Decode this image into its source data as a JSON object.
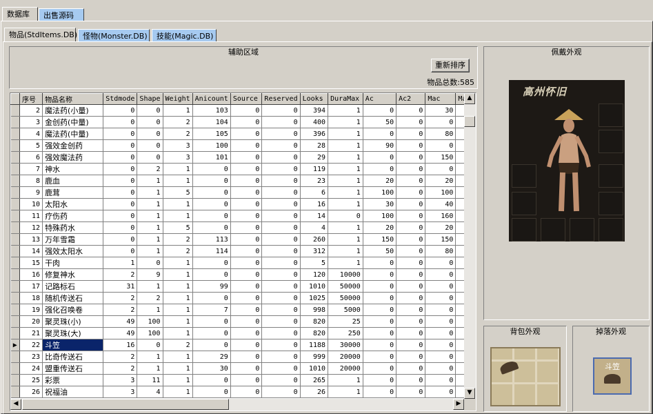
{
  "top_tabs": [
    "数据库",
    "出售源码"
  ],
  "db_tabs": [
    "物品(StdItems.DB)",
    "怪物(Monster.DB)",
    "技能(Magic.DB)"
  ],
  "aux": {
    "title": "辅助区域",
    "resort_button": "重新排序",
    "total_label": "物品总数:585"
  },
  "panels": {
    "wear_title": "佩戴外观",
    "bag_title": "背包外观",
    "drop_title": "掉落外观",
    "drop_item_label": "斗笠",
    "wear_banner": "高州怀旧"
  },
  "columns": [
    "",
    "序号",
    "物品名称",
    "Stdmode",
    "Shape",
    "Weight",
    "Anicount",
    "Source",
    "Reserved",
    "Looks",
    "DuraMax",
    "Ac",
    "Ac2",
    "Mac",
    "Ma"
  ],
  "rows": [
    [
      "2",
      "魔法药(小量)",
      "0",
      "0",
      "1",
      "103",
      "0",
      "0",
      "394",
      "1",
      "0",
      "0",
      "30"
    ],
    [
      "3",
      "金创药(中量)",
      "0",
      "0",
      "2",
      "104",
      "0",
      "0",
      "400",
      "1",
      "50",
      "0",
      "0"
    ],
    [
      "4",
      "魔法药(中量)",
      "0",
      "0",
      "2",
      "105",
      "0",
      "0",
      "396",
      "1",
      "0",
      "0",
      "80"
    ],
    [
      "5",
      "强效金创药",
      "0",
      "0",
      "3",
      "100",
      "0",
      "0",
      "28",
      "1",
      "90",
      "0",
      "0"
    ],
    [
      "6",
      "强效魔法药",
      "0",
      "0",
      "3",
      "101",
      "0",
      "0",
      "29",
      "1",
      "0",
      "0",
      "150"
    ],
    [
      "7",
      "神水",
      "0",
      "2",
      "1",
      "0",
      "0",
      "0",
      "119",
      "1",
      "0",
      "0",
      "0"
    ],
    [
      "8",
      "鹿血",
      "0",
      "1",
      "1",
      "0",
      "0",
      "0",
      "23",
      "1",
      "20",
      "0",
      "20"
    ],
    [
      "9",
      "鹿茸",
      "0",
      "1",
      "5",
      "0",
      "0",
      "0",
      "6",
      "1",
      "100",
      "0",
      "100"
    ],
    [
      "10",
      "太阳水",
      "0",
      "1",
      "1",
      "0",
      "0",
      "0",
      "16",
      "1",
      "30",
      "0",
      "40"
    ],
    [
      "11",
      "疗伤药",
      "0",
      "1",
      "1",
      "0",
      "0",
      "0",
      "14",
      "0",
      "100",
      "0",
      "160"
    ],
    [
      "12",
      "特殊药水",
      "0",
      "1",
      "5",
      "0",
      "0",
      "0",
      "4",
      "1",
      "20",
      "0",
      "20"
    ],
    [
      "13",
      "万年雪霜",
      "0",
      "1",
      "2",
      "113",
      "0",
      "0",
      "260",
      "1",
      "150",
      "0",
      "150"
    ],
    [
      "14",
      "强效太阳水",
      "0",
      "1",
      "2",
      "114",
      "0",
      "0",
      "312",
      "1",
      "50",
      "0",
      "80"
    ],
    [
      "15",
      "干肉",
      "1",
      "0",
      "1",
      "0",
      "0",
      "0",
      "5",
      "1",
      "0",
      "0",
      "0"
    ],
    [
      "16",
      "修复神水",
      "2",
      "9",
      "1",
      "0",
      "0",
      "0",
      "120",
      "10000",
      "0",
      "0",
      "0"
    ],
    [
      "17",
      "记路标石",
      "31",
      "1",
      "1",
      "99",
      "0",
      "0",
      "1010",
      "50000",
      "0",
      "0",
      "0"
    ],
    [
      "18",
      "随机传送石",
      "2",
      "2",
      "1",
      "0",
      "0",
      "0",
      "1025",
      "50000",
      "0",
      "0",
      "0"
    ],
    [
      "19",
      "强化召唤卷",
      "2",
      "1",
      "1",
      "7",
      "0",
      "0",
      "998",
      "5000",
      "0",
      "0",
      "0"
    ],
    [
      "20",
      "聚灵珠(小)",
      "49",
      "100",
      "1",
      "0",
      "0",
      "0",
      "820",
      "25",
      "0",
      "0",
      "0"
    ],
    [
      "21",
      "聚灵珠(大)",
      "49",
      "100",
      "1",
      "0",
      "0",
      "0",
      "820",
      "250",
      "0",
      "0",
      "0"
    ],
    [
      "22",
      "斗笠",
      "16",
      "0",
      "2",
      "0",
      "0",
      "0",
      "1188",
      "30000",
      "0",
      "0",
      "0"
    ],
    [
      "23",
      "比奇传送石",
      "2",
      "1",
      "1",
      "29",
      "0",
      "0",
      "999",
      "20000",
      "0",
      "0",
      "0"
    ],
    [
      "24",
      "盟重传送石",
      "2",
      "1",
      "1",
      "30",
      "0",
      "0",
      "1010",
      "20000",
      "0",
      "0",
      "0"
    ],
    [
      "25",
      "彩票",
      "3",
      "11",
      "1",
      "0",
      "0",
      "0",
      "265",
      "1",
      "0",
      "0",
      "0"
    ],
    [
      "26",
      "祝福油",
      "3",
      "4",
      "1",
      "0",
      "0",
      "0",
      "26",
      "1",
      "0",
      "0",
      "0"
    ]
  ],
  "selected_row_index": 20,
  "colors": {
    "tab_unselected": "#a6caf0",
    "selection": "#0a246a",
    "window_bg": "#d4d0c8"
  }
}
